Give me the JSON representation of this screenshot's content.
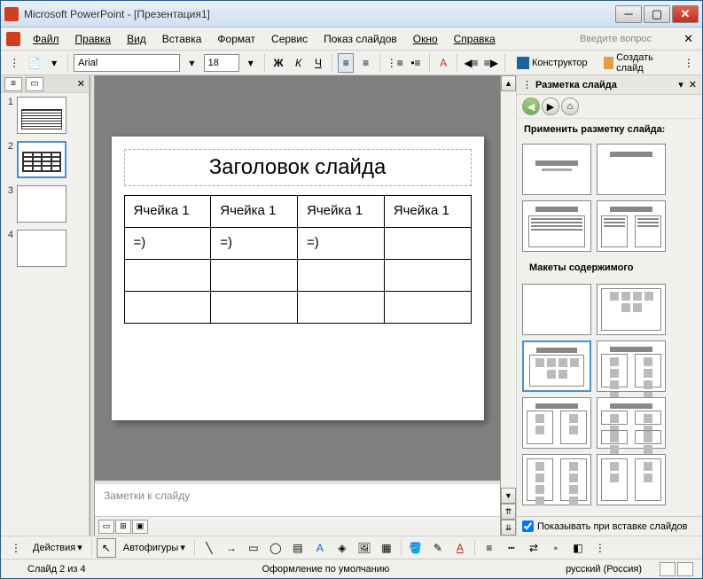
{
  "window": {
    "title": "Microsoft PowerPoint - [Презентация1]"
  },
  "menu": {
    "file": "Файл",
    "edit": "Правка",
    "view": "Вид",
    "insert": "Вставка",
    "format": "Формат",
    "tools": "Сервис",
    "slideshow": "Показ слайдов",
    "window": "Окно",
    "help": "Справка",
    "help_prompt": "Введите вопрос"
  },
  "toolbar": {
    "font": "Arial",
    "size": "18",
    "designer": "Конструктор",
    "new_slide": "Создать слайд"
  },
  "thumbs": [
    "1",
    "2",
    "3",
    "4"
  ],
  "slide": {
    "title": "Заголовок слайда",
    "table": [
      [
        "Ячейка 1",
        "Ячейка 1",
        "Ячейка 1",
        "Ячейка 1"
      ],
      [
        "=)",
        "=)",
        "=)",
        ""
      ],
      [
        "",
        "",
        "",
        ""
      ],
      [
        "",
        "",
        "",
        ""
      ]
    ]
  },
  "notes": {
    "placeholder": "Заметки к слайду"
  },
  "taskpane": {
    "title": "Разметка слайда",
    "apply": "Применить разметку слайда:",
    "section2": "Макеты содержимого",
    "show_on_insert": "Показывать при вставке слайдов"
  },
  "draw": {
    "actions": "Действия",
    "autoshapes": "Автофигуры"
  },
  "status": {
    "slide": "Слайд 2 из 4",
    "design": "Оформление по умолчанию",
    "lang": "русский (Россия)"
  }
}
